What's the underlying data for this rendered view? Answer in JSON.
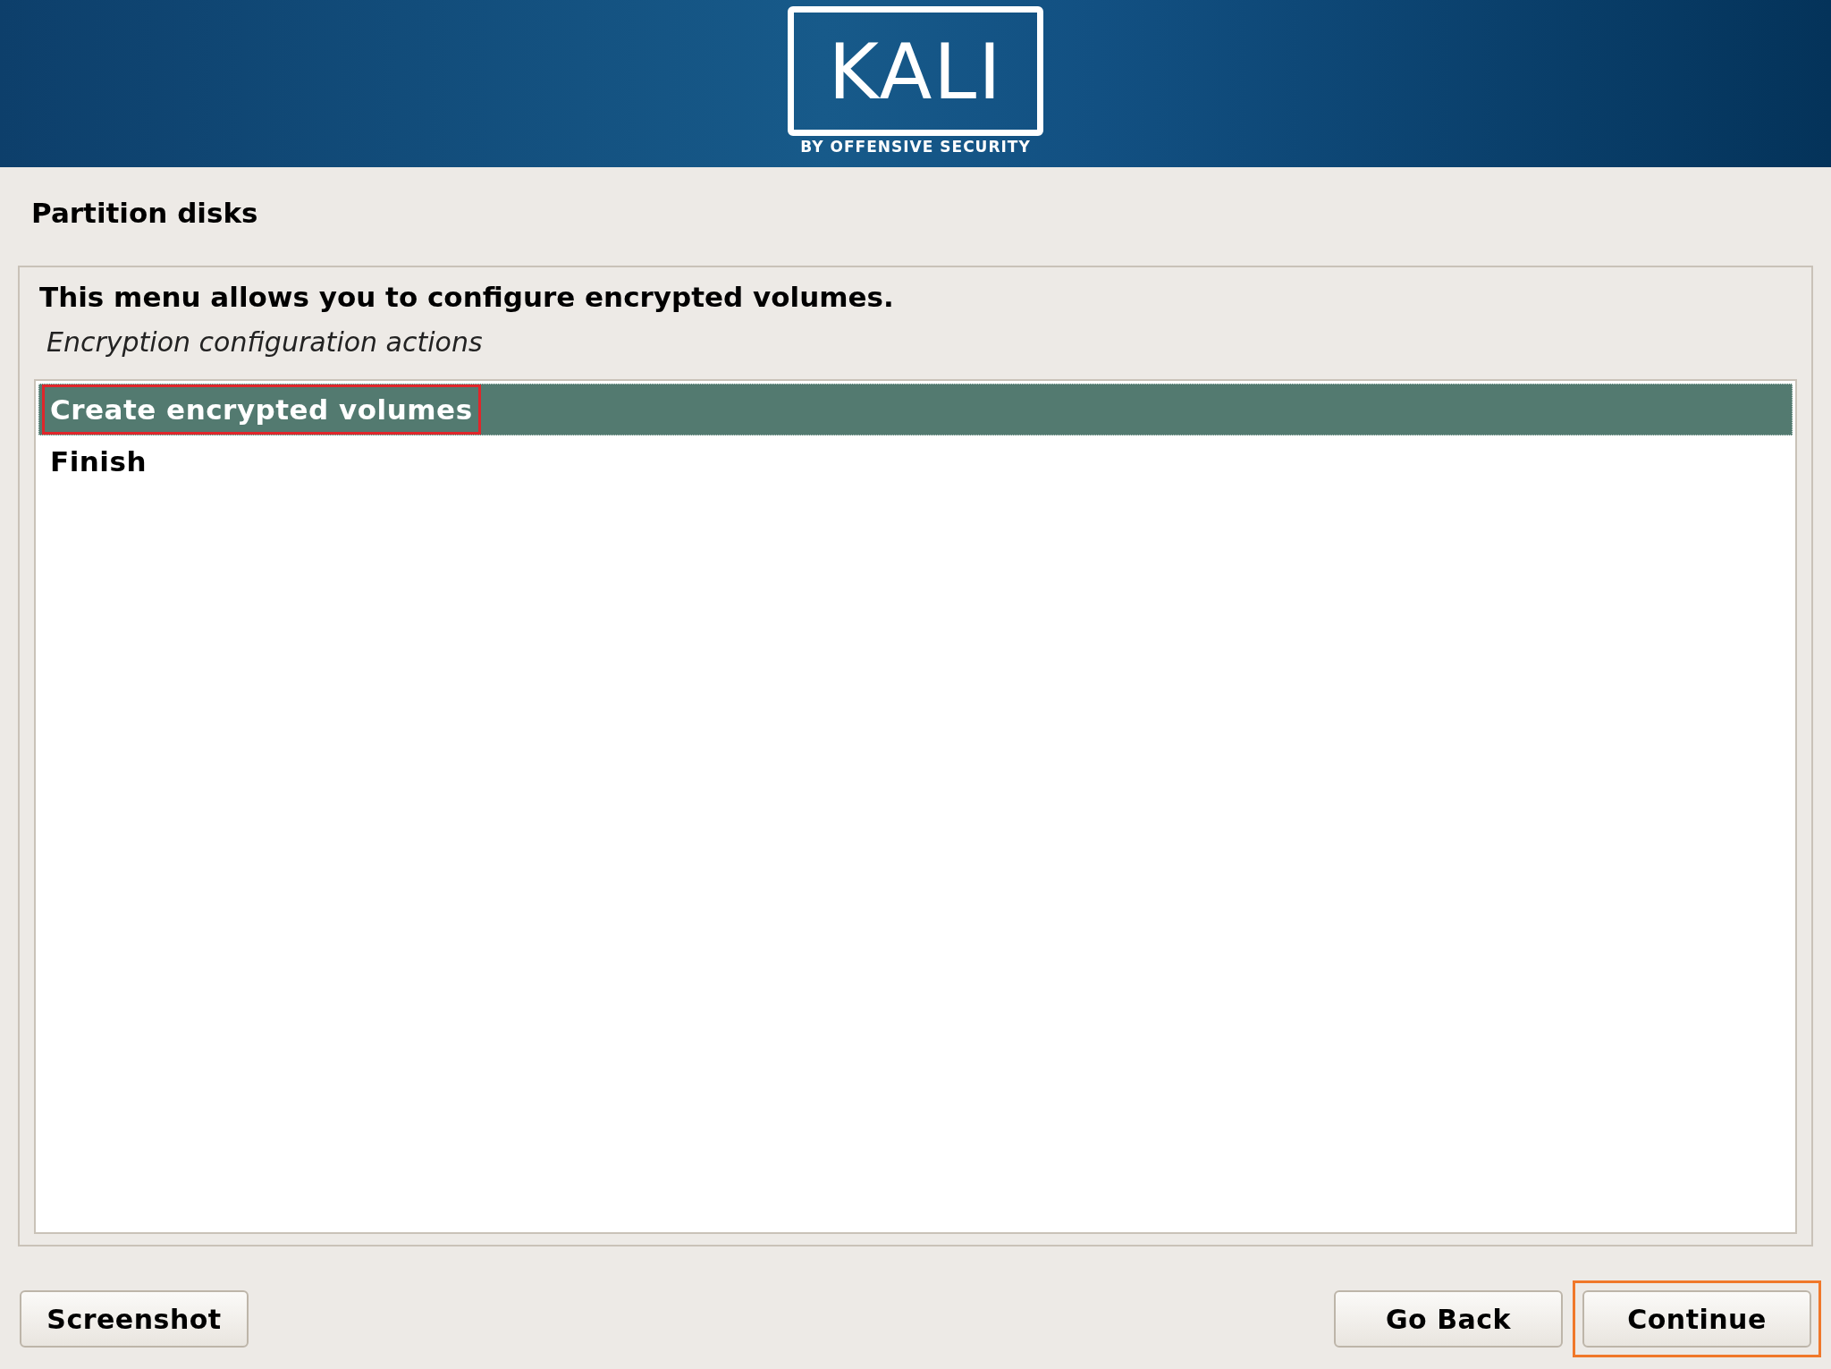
{
  "header": {
    "logo_text": "KALI",
    "tagline": "BY OFFENSIVE SECURITY"
  },
  "page_title": "Partition disks",
  "panel": {
    "heading": "This menu allows you to configure encrypted volumes.",
    "subheading": "Encryption configuration actions",
    "items": [
      {
        "label": "Create encrypted volumes",
        "selected": true,
        "highlighted": true
      },
      {
        "label": "Finish",
        "selected": false,
        "highlighted": false
      }
    ]
  },
  "buttons": [
    {
      "label": "Screenshot",
      "highlighted": false
    },
    {
      "label": "Go Back",
      "highlighted": false
    },
    {
      "label": "Continue",
      "highlighted": true
    }
  ]
}
